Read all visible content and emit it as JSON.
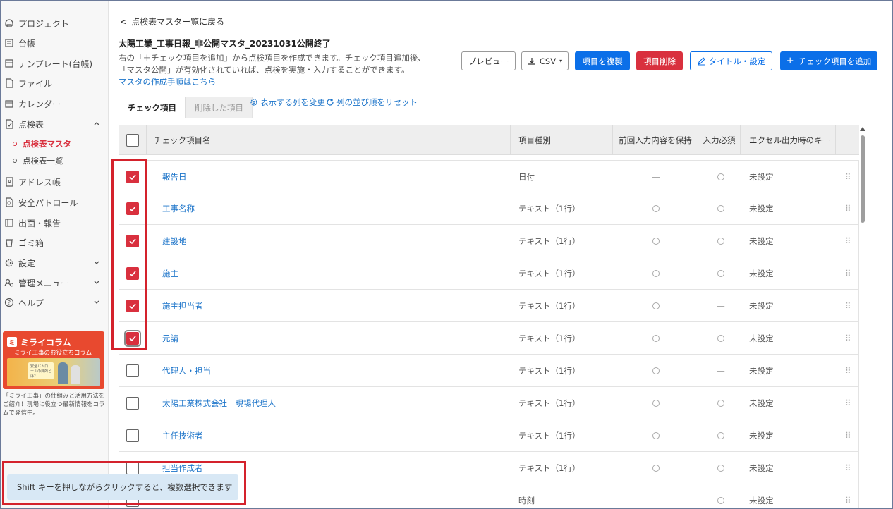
{
  "sidebar": {
    "items": [
      {
        "label": "プロジェクト",
        "icon": "project-icon"
      },
      {
        "label": "台帳",
        "icon": "ledger-icon"
      },
      {
        "label": "テンプレート(台帳)",
        "icon": "template-icon"
      },
      {
        "label": "ファイル",
        "icon": "file-icon"
      },
      {
        "label": "カレンダー",
        "icon": "calendar-icon"
      },
      {
        "label": "点検表",
        "icon": "checklist-icon"
      },
      {
        "label": "アドレス帳",
        "icon": "address-book-icon"
      },
      {
        "label": "安全パトロール",
        "icon": "patrol-icon"
      },
      {
        "label": "出面・報告",
        "icon": "report-icon"
      },
      {
        "label": "ゴミ箱",
        "icon": "trash-icon"
      },
      {
        "label": "設定",
        "icon": "settings-icon"
      },
      {
        "label": "管理メニュー",
        "icon": "admin-icon"
      },
      {
        "label": "ヘルプ",
        "icon": "help-icon"
      }
    ],
    "sub_items": [
      {
        "label": "点検表マスタ",
        "active": true
      },
      {
        "label": "点検表一覧",
        "active": false
      }
    ],
    "banner": {
      "title": "ミライコラム",
      "subtitle": "ミライ工事のお役立ちコラム",
      "card_text": "安全パトロールの目的とは?",
      "description": "「ミライ工事」の仕組みと活用方法をご紹介！現場に役立つ最新情報をコラムで発信中。"
    }
  },
  "header": {
    "back_label": "点検表マスター覧に戻る",
    "master_title": "太陽工業_工事日報_非公開マスタ_20231031公開終了",
    "description_line1": "右の「＋チェック項目を追加」から点検項目を作成できます。チェック項目追加後、",
    "description_line2": "「マスタ公開」が有効化されていれば、点検を実施・入力することができます。",
    "guide_link": "マスタの作成手順はこちら"
  },
  "toolbar": {
    "preview": "プレビュー",
    "csv": "CSV",
    "duplicate": "項目を複製",
    "delete": "項目削除",
    "title_settings": "タイトル・設定",
    "add_item": "チェック項目を追加"
  },
  "tabs": {
    "items": [
      "チェック項目",
      "削除した項目"
    ],
    "change_columns": "表示する列を変更",
    "reset_order": "列の並び順をリセット"
  },
  "table": {
    "headers": [
      "チェック項目名",
      "項目種別",
      "前回入力内容を保持",
      "入力必須",
      "エクセル出力時のキー"
    ],
    "rows": [
      {
        "name": "報告日",
        "type": "日付",
        "keep": "dash",
        "required": "circle",
        "key": "未設定",
        "checked": true
      },
      {
        "name": "工事名称",
        "type": "テキスト（1行）",
        "keep": "circle",
        "required": "circle",
        "key": "未設定",
        "checked": true
      },
      {
        "name": "建設地",
        "type": "テキスト（1行）",
        "keep": "circle",
        "required": "circle",
        "key": "未設定",
        "checked": true
      },
      {
        "name": "施主",
        "type": "テキスト（1行）",
        "keep": "circle",
        "required": "circle",
        "key": "未設定",
        "checked": true
      },
      {
        "name": "施主担当者",
        "type": "テキスト（1行）",
        "keep": "circle",
        "required": "dash",
        "key": "未設定",
        "checked": true
      },
      {
        "name": "元請",
        "type": "テキスト（1行）",
        "keep": "circle",
        "required": "circle",
        "key": "未設定",
        "checked": true
      },
      {
        "name": "代理人・担当",
        "type": "テキスト（1行）",
        "keep": "circle",
        "required": "dash",
        "key": "未設定",
        "checked": false
      },
      {
        "name": "太陽工業株式会社　現場代理人",
        "type": "テキスト（1行）",
        "keep": "circle",
        "required": "circle",
        "key": "未設定",
        "checked": false
      },
      {
        "name": "主任技術者",
        "type": "テキスト（1行）",
        "keep": "circle",
        "required": "circle",
        "key": "未設定",
        "checked": false
      },
      {
        "name": "担当作成者",
        "type": "テキスト（1行）",
        "keep": "circle",
        "required": "circle",
        "key": "未設定",
        "checked": false
      },
      {
        "name": "",
        "type": "時刻",
        "keep": "dash",
        "required": "circle",
        "key": "未設定",
        "checked": false
      }
    ]
  },
  "toast": {
    "message": "Shift キーを押しながらクリックすると、複数選択できます"
  },
  "colors": {
    "accent_red": "#d9303e",
    "primary_blue": "#0b6fe8",
    "link_blue": "#1a73c9",
    "annotation_red": "#d4222c"
  }
}
